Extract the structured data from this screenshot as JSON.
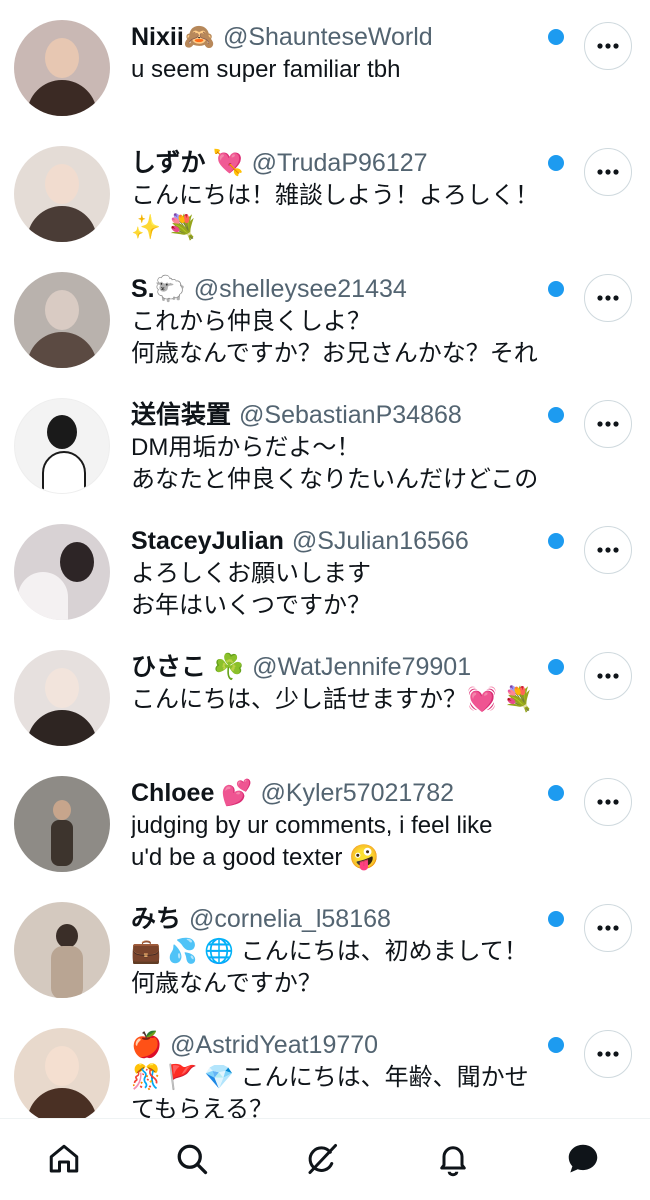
{
  "conversations": [
    {
      "name": "Nixii🙈",
      "handle": "@ShaunteseWorld",
      "message": "u seem super familiar tbh",
      "avatar_bg": "#c9b8b4",
      "avatar_fg": "#3b2a24"
    },
    {
      "name": "しずか 💘",
      "handle": "@TrudaP96127",
      "message": "こんにちは！雑談しよう！よろしく！\n✨ 💐",
      "avatar_bg": "#e4dcd6",
      "avatar_fg": "#4a3c36"
    },
    {
      "name": "S.🐑",
      "handle": "@shelleysee21434",
      "message": "これから仲良くしよ？\n何歳なんですか？お兄さんかな？それ",
      "avatar_bg": "#b9b2ad",
      "avatar_fg": "#5b4a42"
    },
    {
      "name": "送信装置",
      "handle": "@SebastianP34868",
      "message": "DM用垢からだよ〜！\nあなたと仲良くなりたいんだけどこの",
      "avatar_bg": "#f3f3f3",
      "avatar_fg": "#1a1a1a"
    },
    {
      "name": "StaceyJulian",
      "handle": "@SJulian16566",
      "message": "よろしくお願いします\nお年はいくつですか？",
      "avatar_bg": "#d8d2d4",
      "avatar_fg": "#2d2526"
    },
    {
      "name": "ひさこ ☘️",
      "handle": "@WatJennife79901",
      "message": "こんにちは、少し話せますか？💓 💐",
      "avatar_bg": "#e6e0de",
      "avatar_fg": "#2e2522"
    },
    {
      "name": "Chloee 💕",
      "handle": "@Kyler57021782",
      "message": "judging by ur comments, i feel like\nu'd be a good texter 🤪",
      "avatar_bg": "#8e8b86",
      "avatar_fg": "#3d342d"
    },
    {
      "name": "みち",
      "handle": "@cornelia_l58168",
      "message": "💼 💦 🌐 こんにちは、初めまして！\n何歳なんですか？",
      "avatar_bg": "#d4c9bf",
      "avatar_fg": "#50443a"
    },
    {
      "name": "🍎",
      "handle": "@AstridYeat19770",
      "message": "🎊 🚩 💎 こんにちは、年齢、聞かせ\nてもらえる？",
      "avatar_bg": "#e8d9cc",
      "avatar_fg": "#4a3024"
    }
  ],
  "colors": {
    "unread_dot": "#1d9bf0",
    "handle_text": "#536471",
    "primary_text": "#0f1419"
  },
  "tabbar": [
    {
      "icon": "home-icon"
    },
    {
      "icon": "search-icon"
    },
    {
      "icon": "grok-icon"
    },
    {
      "icon": "bell-icon"
    },
    {
      "icon": "messages-icon",
      "active": true
    }
  ]
}
